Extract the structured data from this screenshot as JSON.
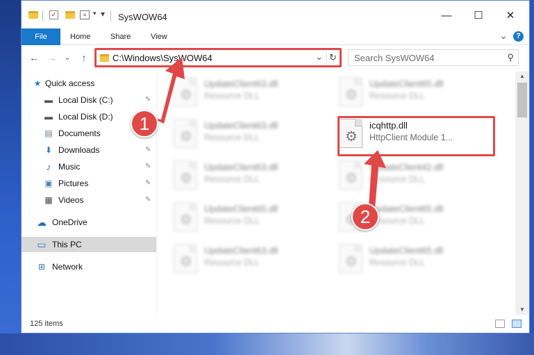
{
  "window": {
    "title": "SysWOW64",
    "minimize": "—",
    "maximize": "☐",
    "close": "✕"
  },
  "ribbon": {
    "tabs": [
      "File",
      "Home",
      "Share",
      "View"
    ],
    "expand": "⌄",
    "help": "?"
  },
  "nav": {
    "back": "←",
    "forward": "→",
    "recent": "⌄",
    "up": "↑",
    "address": "C:\\Windows\\SysWOW64",
    "address_dropdown": "⌄",
    "refresh": "↻",
    "search_placeholder": "Search SysWOW64",
    "search_glyph": "⚲"
  },
  "sidebar": {
    "items": [
      {
        "label": "Quick access",
        "icon": "star-icon",
        "glyph": "★",
        "color": "#2b79c9",
        "pinned": false
      },
      {
        "label": "Local Disk (C:)",
        "icon": "drive-icon",
        "glyph": "▬",
        "color": "#555555",
        "pinned": true
      },
      {
        "label": "Local Disk (D:)",
        "icon": "drive-icon",
        "glyph": "▬",
        "color": "#555555",
        "pinned": true
      },
      {
        "label": "Documents",
        "icon": "documents-icon",
        "glyph": "▤",
        "color": "#6a7a8a",
        "pinned": true
      },
      {
        "label": "Downloads",
        "icon": "downloads-icon",
        "glyph": "⬇",
        "color": "#2b79c9",
        "pinned": true
      },
      {
        "label": "Music",
        "icon": "music-icon",
        "glyph": "♪",
        "color": "#2b79c9",
        "pinned": true
      },
      {
        "label": "Pictures",
        "icon": "pictures-icon",
        "glyph": "▣",
        "color": "#4a7fb5",
        "pinned": true
      },
      {
        "label": "Videos",
        "icon": "videos-icon",
        "glyph": "▦",
        "color": "#444444",
        "pinned": true
      },
      {
        "label": "OneDrive",
        "icon": "onedrive-icon",
        "glyph": "☁",
        "color": "#1f6fc5",
        "pinned": false
      },
      {
        "label": "This PC",
        "icon": "computer-icon",
        "glyph": "▭",
        "color": "#2b79c9",
        "pinned": false
      },
      {
        "label": "Network",
        "icon": "network-icon",
        "glyph": "⊞",
        "color": "#2b79c9",
        "pinned": false
      }
    ],
    "pin_glyph": "📌"
  },
  "files": [
    {
      "name": "UpdateClient63.dll",
      "desc": "Resource DLL",
      "blurred": true
    },
    {
      "name": "UpdateClient65.dll",
      "desc": "Resource DLL",
      "blurred": true
    },
    {
      "name": "UpdateClient63.dll",
      "desc": "Resource DLL",
      "blurred": true
    },
    {
      "name": "icqhttp.dll",
      "desc": "HttpClient Module 1...",
      "blurred": false
    },
    {
      "name": "UpdateClient63.dll",
      "desc": "Resource DLL",
      "blurred": true
    },
    {
      "name": "UpdateClient42.dll",
      "desc": "Resource DLL",
      "blurred": true
    },
    {
      "name": "UpdateClient65.dll",
      "desc": "Resource DLL",
      "blurred": true
    },
    {
      "name": "UpdateClient65.dll",
      "desc": "Resource DLL",
      "blurred": true
    },
    {
      "name": "UpdateClient63.dll",
      "desc": "Resource DLL",
      "blurred": true
    },
    {
      "name": "UpdateClient65.dll",
      "desc": "Resource DLL",
      "blurred": true
    }
  ],
  "status": {
    "item_count": "125 items"
  },
  "annotations": {
    "step1": "1",
    "step2": "2",
    "color": "#e04848"
  }
}
